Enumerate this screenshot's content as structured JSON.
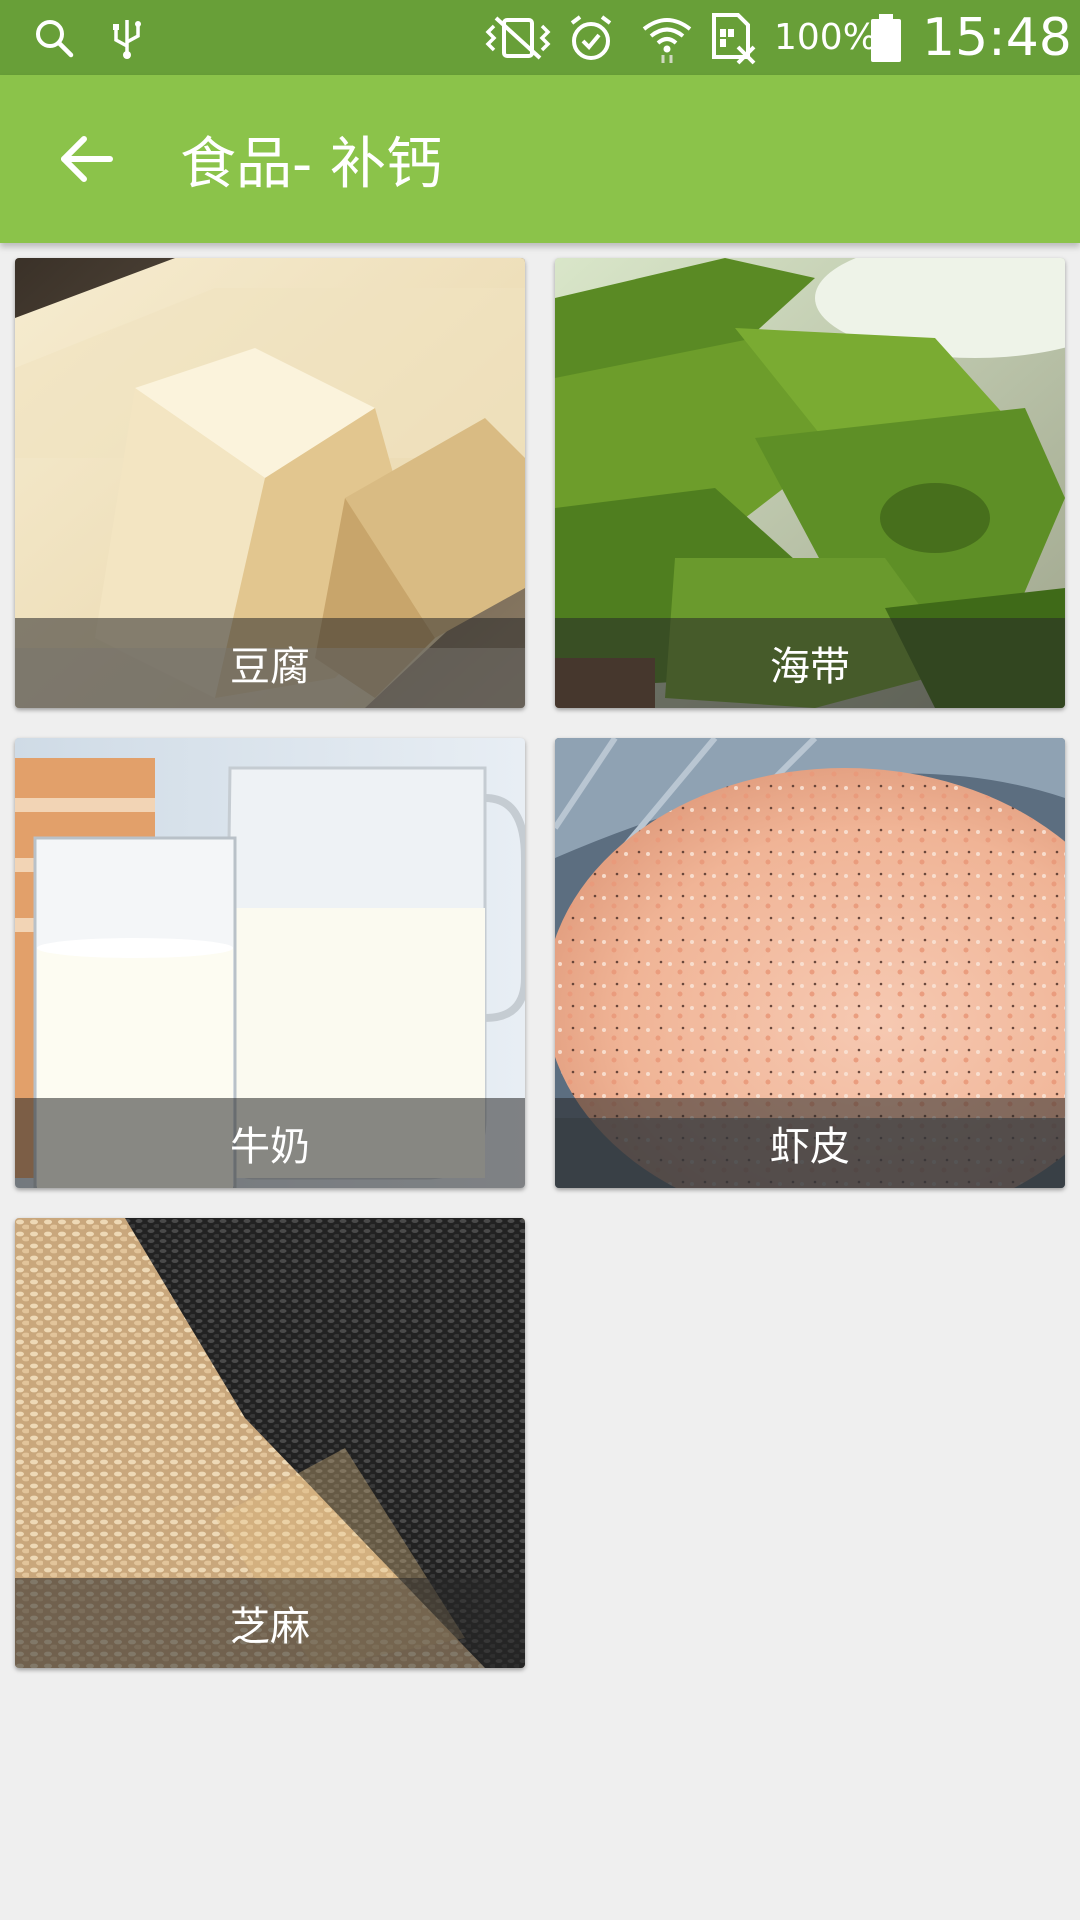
{
  "status_bar": {
    "icons": [
      "search-icon",
      "usb-icon",
      "vibrate-mute-icon",
      "alarm-icon",
      "wifi-icon",
      "no-sim-icon",
      "battery-icon"
    ],
    "battery_percent": "100%",
    "time": "15:48"
  },
  "toolbar": {
    "back_icon": "arrow-back-icon",
    "title": "食品- 补钙",
    "background_color": "#8bc34a"
  },
  "items": [
    {
      "label": "豆腐",
      "image": "tofu-photo"
    },
    {
      "label": "海带",
      "image": "kelp-photo"
    },
    {
      "label": "牛奶",
      "image": "milk-photo"
    },
    {
      "label": "虾皮",
      "image": "dried-shrimp-photo"
    },
    {
      "label": "芝麻",
      "image": "sesame-photo"
    }
  ]
}
